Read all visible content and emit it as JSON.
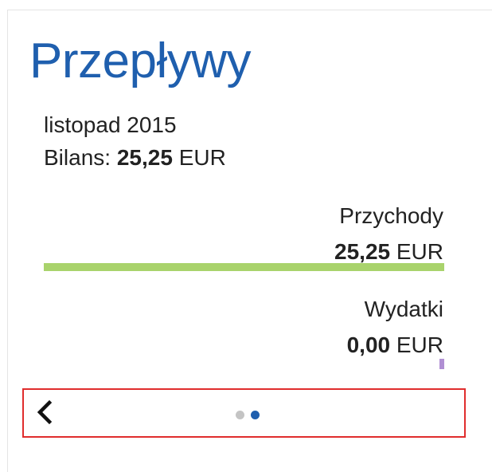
{
  "widget": {
    "title": "Przepływy",
    "period": "listopad 2015",
    "balance": {
      "label": "Bilans:",
      "value": "25,25",
      "currency": "EUR"
    },
    "income": {
      "label": "Przychody",
      "value": "25,25",
      "currency": "EUR",
      "bar_fraction": 1.0,
      "bar_color": "#a9d36c"
    },
    "expenses": {
      "label": "Wydatki",
      "value": "0,00",
      "currency": "EUR",
      "bar_fraction": 0.0,
      "bar_color": "#b08fd3"
    },
    "pager": {
      "prev_icon": "chevron-left-icon",
      "page_count": 2,
      "active_page": 2,
      "dot_color_inactive": "#c4c4c4",
      "dot_color_active": "#1f5fae"
    }
  }
}
